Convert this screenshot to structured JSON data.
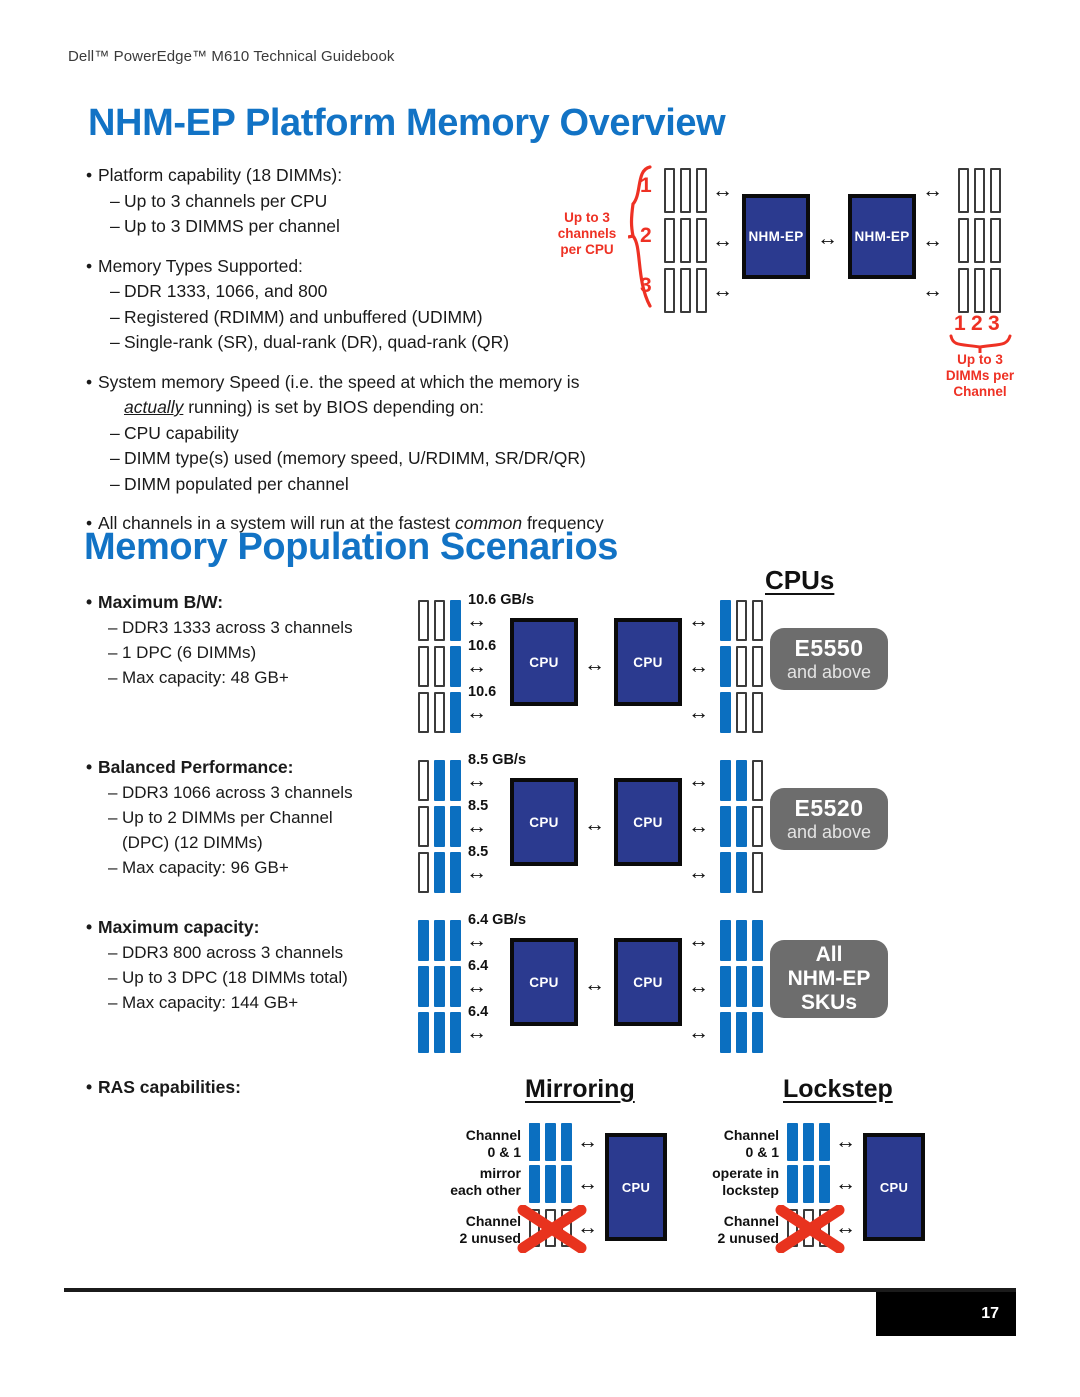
{
  "header": {
    "text": "Dell™ PowerEdge™ M610 Technical Guidebook"
  },
  "sections": {
    "overview_title": "NHM-EP Platform Memory Overview",
    "scenarios_title": "Memory Population Scenarios"
  },
  "overview_bullets": {
    "b1": "Platform capability (18 DIMMs):",
    "b1s1": "Up to 3 channels per CPU",
    "b1s2": "Up to 3 DIMMS per channel",
    "b2": "Memory Types Supported:",
    "b2s1": "DDR 1333, 1066, and 800",
    "b2s2": "Registered (RDIMM) and unbuffered (UDIMM)",
    "b2s3": "Single-rank (SR), dual-rank (DR), quad-rank (QR)",
    "b3a": "System memory Speed (i.e. the speed at which the memory is",
    "b3b_em": "actually",
    "b3b": " running) is set by BIOS depending on:",
    "b3s1": "CPU capability",
    "b3s2": "DIMM type(s) used (memory speed, U/RDIMM, SR/DR/QR)",
    "b3s3": "DIMM populated per channel",
    "b4a": "All channels in a system will run at the fastest ",
    "b4_em": "common",
    "b4b": " frequency"
  },
  "overview_diagram": {
    "left_note": "Up to 3\nchannels\nper CPU",
    "left_note_l1": "Up to 3",
    "left_note_l2": "channels",
    "left_note_l3": "per CPU",
    "channel_numbers": [
      "1",
      "2",
      "3"
    ],
    "proc_left_label": "NHM-EP",
    "proc_right_label": "NHM-EP",
    "dimm_numbers": [
      "1",
      "2",
      "3"
    ],
    "right_note_l1": "Up to 3",
    "right_note_l2": "DIMMs per",
    "right_note_l3": "Channel",
    "slot_fill_left": [
      [
        "off",
        "off",
        "off"
      ],
      [
        "off",
        "off",
        "off"
      ],
      [
        "off",
        "off",
        "off"
      ]
    ],
    "slot_fill_right": [
      [
        "off",
        "off",
        "off"
      ],
      [
        "off",
        "off",
        "off"
      ],
      [
        "off",
        "off",
        "off"
      ]
    ]
  },
  "cpus_heading": "CPUs",
  "scenarios": [
    {
      "id": "maximum-bw",
      "heading": "Maximum B/W:",
      "lines": [
        "DDR3 1333 across 3 channels",
        "1 DPC (6 DIMMs)",
        "Max capacity: 48 GB+"
      ],
      "bandwidth_top": "10.6 GB/s",
      "bandwidth_rows": [
        "10.6",
        "10.6",
        "10.6"
      ],
      "proc_label": "CPU",
      "slot_fill_left": [
        [
          "off",
          "off",
          "on"
        ],
        [
          "off",
          "off",
          "on"
        ],
        [
          "off",
          "off",
          "on"
        ]
      ],
      "slot_fill_right": [
        [
          "on",
          "off",
          "off"
        ],
        [
          "on",
          "off",
          "off"
        ],
        [
          "on",
          "off",
          "off"
        ]
      ],
      "sku_line1": "E5550",
      "sku_line2": "and above"
    },
    {
      "id": "balanced-performance",
      "heading": "Balanced Performance:",
      "lines": [
        "DDR3 1066 across 3 channels",
        "Up to 2 DIMMs per Channel",
        "(DPC) (12 DIMMs)",
        "Max capacity: 96 GB+"
      ],
      "bandwidth_top": "8.5 GB/s",
      "bandwidth_rows": [
        "8.5",
        "8.5",
        "8.5"
      ],
      "proc_label": "CPU",
      "slot_fill_left": [
        [
          "off",
          "on",
          "on"
        ],
        [
          "off",
          "on",
          "on"
        ],
        [
          "off",
          "on",
          "on"
        ]
      ],
      "slot_fill_right": [
        [
          "on",
          "on",
          "off"
        ],
        [
          "on",
          "on",
          "off"
        ],
        [
          "on",
          "on",
          "off"
        ]
      ],
      "sku_line1": "E5520",
      "sku_line2": "and above"
    },
    {
      "id": "maximum-capacity",
      "heading": "Maximum capacity:",
      "lines": [
        "DDR3 800 across 3 channels",
        "Up to 3 DPC (18 DIMMs total)",
        "Max capacity: 144 GB+"
      ],
      "bandwidth_top": "6.4 GB/s",
      "bandwidth_rows": [
        "6.4",
        "6.4",
        "6.4"
      ],
      "proc_label": "CPU",
      "slot_fill_left": [
        [
          "on",
          "on",
          "on"
        ],
        [
          "on",
          "on",
          "on"
        ],
        [
          "on",
          "on",
          "on"
        ]
      ],
      "slot_fill_right": [
        [
          "on",
          "on",
          "on"
        ],
        [
          "on",
          "on",
          "on"
        ],
        [
          "on",
          "on",
          "on"
        ]
      ],
      "sku_line1": "All",
      "sku_line2": "NHM-EP",
      "sku_line3": "SKUs"
    }
  ],
  "ras": {
    "heading": "RAS capabilities:",
    "mirroring": {
      "title": "Mirroring",
      "label_l1": "Channel",
      "label_l2": "0 & 1",
      "label_l3": "mirror",
      "label_l4": "each other",
      "unused_l1": "Channel",
      "unused_l2": "2 unused",
      "proc_label": "CPU",
      "slot_fill": [
        [
          "on",
          "on",
          "on"
        ],
        [
          "on",
          "on",
          "on"
        ],
        [
          "off",
          "off",
          "off"
        ]
      ]
    },
    "lockstep": {
      "title": "Lockstep",
      "label_l1": "Channel",
      "label_l2": "0 & 1",
      "label_l3": "operate in",
      "label_l4": "lockstep",
      "unused_l1": "Channel",
      "unused_l2": "2 unused",
      "proc_label": "CPU",
      "slot_fill": [
        [
          "on",
          "on",
          "on"
        ],
        [
          "on",
          "on",
          "on"
        ],
        [
          "off",
          "off",
          "off"
        ]
      ]
    }
  },
  "footer": {
    "page_number": "17"
  },
  "colors": {
    "heading_blue": "#1273c5",
    "dimm_blue": "#0b6fc0",
    "proc_navy": "#2b3a8f",
    "accent_red": "#ee3124",
    "pill_grey": "#6d6d6d"
  }
}
